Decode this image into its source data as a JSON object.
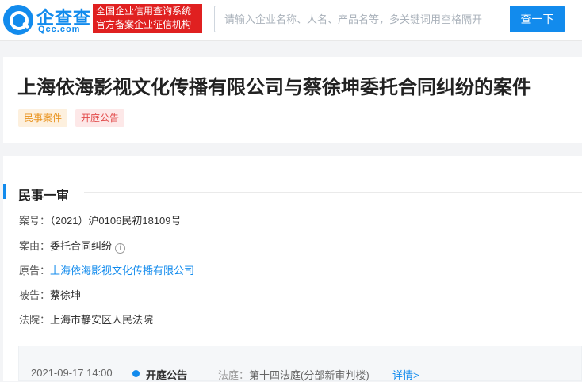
{
  "header": {
    "logo_cn": "企查查",
    "logo_en": "Qcc.com",
    "cert_line1": "全国企业信用查询系统",
    "cert_line2": "官方备案企业征信机构",
    "search_placeholder": "请输入企业名称、人名、产品名等，多关键词用空格隔开",
    "search_button": "查一下"
  },
  "case": {
    "title": "上海依海影视文化传播有限公司与蔡徐坤委托合同纠纷的案件",
    "tags": [
      "民事案件",
      "开庭公告"
    ]
  },
  "detail": {
    "section_title": "民事一审",
    "rows": [
      {
        "label": "案号：",
        "value": "（2021）沪0106民初18109号"
      },
      {
        "label": "案由：",
        "value": "委托合同纠纷"
      },
      {
        "label": "原告：",
        "value": "上海依海影视文化传播有限公司"
      },
      {
        "label": "被告：",
        "value": "蔡徐坤"
      },
      {
        "label": "法院：",
        "value": "上海市静安区人民法院"
      }
    ],
    "timeline": {
      "time": "2021-09-17 14:00",
      "type": "开庭公告",
      "court_label": "法庭：",
      "court_value": "第十四法庭(分部新审判楼)",
      "detail_link": "详情>"
    }
  },
  "colors": {
    "accent": "#128bed",
    "cert_red": "#e02020",
    "tag_civil_text": "#e89019",
    "tag_hearing_text": "#e24c4c"
  }
}
